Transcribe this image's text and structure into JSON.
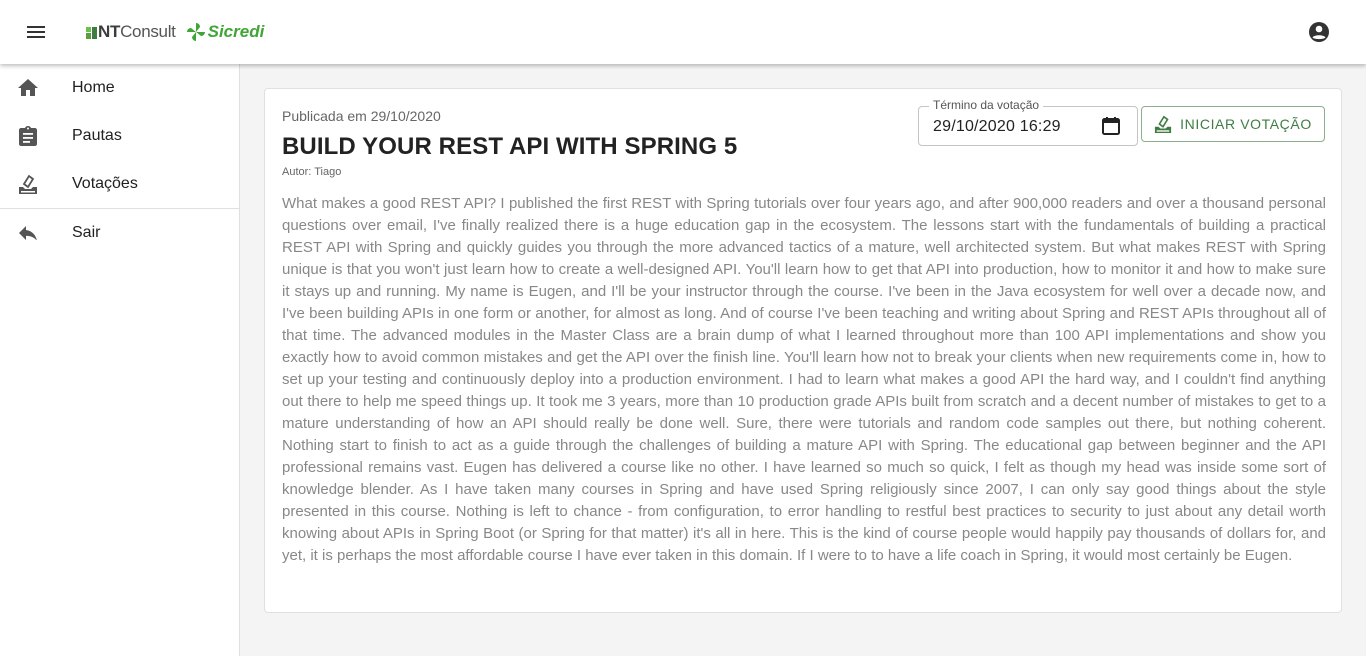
{
  "header": {
    "menu_icon": "menu-icon",
    "logo": {
      "nt_prefix": "NT",
      "nt_suffix": "Consult",
      "brand": "Sicredi"
    },
    "account_icon": "account-circle-icon"
  },
  "sidebar": {
    "items": [
      {
        "label": "Home",
        "icon": "home-icon"
      },
      {
        "label": "Pautas",
        "icon": "clipboard-icon"
      },
      {
        "label": "Votações",
        "icon": "ballot-icon"
      },
      {
        "label": "Sair",
        "icon": "reply-icon"
      }
    ]
  },
  "card": {
    "published": "Publicada em 29/10/2020",
    "title": "BUILD YOUR REST API WITH SPRING 5",
    "author": "Autor: Tiago",
    "date_field": {
      "label": "Término da votação",
      "value": "29/10/2020 16:29"
    },
    "start_button": "INICIAR VOTAÇÃO",
    "description": "What makes a good REST API? I published the first REST with Spring tutorials over four years ago, and after 900,000 readers and over a thousand personal questions over email, I've finally realized there is a huge education gap in the ecosystem. The lessons start with the fundamentals of building a practical REST API with Spring and quickly guides you through the more advanced tactics of a mature, well architected system. But what makes REST with Spring unique is that you won't just learn how to create a well-designed API. You'll learn how to get that API into production, how to monitor it and how to make sure it stays up and running. My name is Eugen, and I'll be your instructor through the course. I've been in the Java ecosystem for well over a decade now, and I've been building APIs in one form or another, for almost as long. And of course I've been teaching and writing about Spring and REST APIs throughout all of that time. The advanced modules in the Master Class are a brain dump of what I learned throughout more than 100 API implementations and show you exactly how to avoid common mistakes and get the API over the finish line. You'll learn how not to break your clients when new requirements come in, how to set up your testing and continuously deploy into a production environment. I had to learn what makes a good API the hard way, and I couldn't find anything out there to help me speed things up. It took me 3 years, more than 10 production grade APIs built from scratch and a decent number of mistakes to get to a mature understanding of how an API should really be done well. Sure, there were tutorials and random code samples out there, but nothing coherent. Nothing start to finish to act as a guide through the challenges of building a mature API with Spring. The educational gap between beginner and the API professional remains vast. Eugen has delivered a course like no other. I have learned so much so quick, I felt as though my head was inside some sort of knowledge blender. As I have taken many courses in Spring and have used Spring religiously since 2007, I can only say good things about the style presented in this course. Nothing is left to chance - from configuration, to error handling to restful best practices to security to just about any detail worth knowing about APIs in Spring Boot (or Spring for that matter) it's all in here. This is the kind of course people would happily pay thousands of dollars for, and yet, it is perhaps the most affordable course I have ever taken in this domain. If I were to to have a life coach in Spring, it would most certainly be Eugen."
  },
  "colors": {
    "accent_green": "#3f7d43",
    "brand_green": "#3fa535",
    "nt_green": "#57a03d"
  }
}
